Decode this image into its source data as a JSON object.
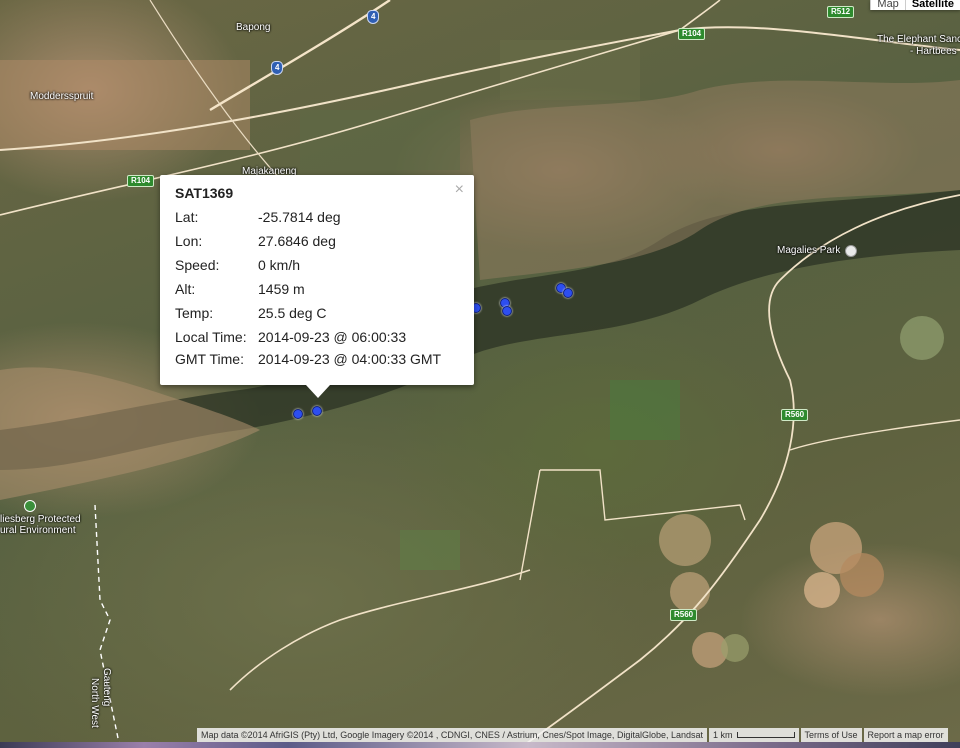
{
  "map_type": {
    "map_label": "Map",
    "satellite_label": "Satellite",
    "active": "Satellite"
  },
  "places": {
    "bapong": "Bapong",
    "moddersspruit": "Moddersspruit",
    "majakaneng": "Majakaneng",
    "elephant": "The Elephant Sanc",
    "hartbees": "- Hartbees",
    "magalies_park": "Magalies Park",
    "protected_1": "liesberg Protected",
    "protected_2": "ural Environment",
    "north_west": "North West",
    "gauteng": "Gauteng"
  },
  "roads": {
    "n4_a": "4",
    "n4_b": "4",
    "r512": "R512",
    "r104_a": "R104",
    "r104_b": "R104",
    "r560_a": "R560",
    "r560_b": "R560"
  },
  "info_window": {
    "title": "SAT1369",
    "close": "×",
    "rows": [
      {
        "label": "Lat:",
        "value": "-25.7814 deg"
      },
      {
        "label": "Lon:",
        "value": "27.6846 deg"
      },
      {
        "label": "Speed:",
        "value": "0 km/h"
      },
      {
        "label": "Alt:",
        "value": "1459 m"
      },
      {
        "label": "Temp:",
        "value": "25.5 deg C"
      },
      {
        "label": "Local Time:",
        "value": "2014-09-23 @ 06:00:33"
      },
      {
        "label": "GMT Time:",
        "value": "2014-09-23 @ 04:00:33 GMT"
      }
    ]
  },
  "attribution": {
    "map_data": "Map data ©2014 AfriGIS (Pty) Ltd, Google Imagery ©2014 , CDNGI, CNES / Astrium, Cnes/Spot Image, DigitalGlobe, Landsat",
    "scale": "1 km",
    "terms": "Terms of Use",
    "report": "Report a map error"
  },
  "colors": {
    "marker": "#2d4ef0",
    "road_shield": "#2e8a2e",
    "highway_shield": "#2f5fb4"
  }
}
